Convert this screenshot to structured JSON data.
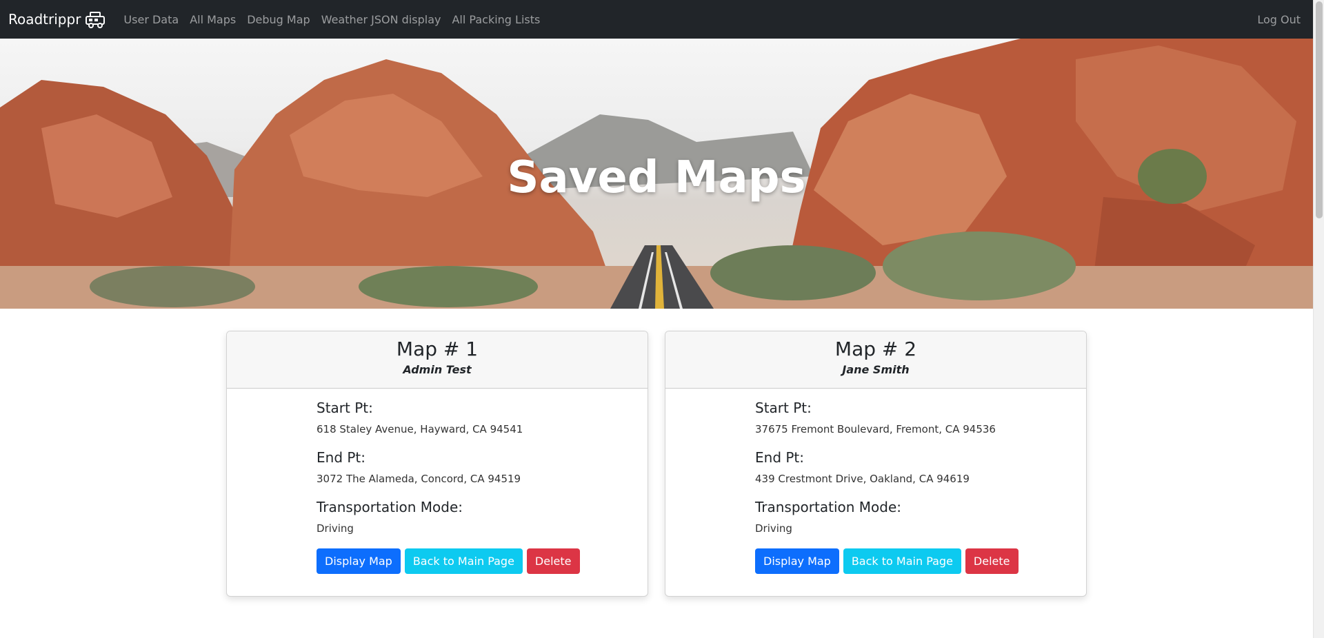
{
  "navbar": {
    "brand": "Roadtrippr",
    "brand_icon": "camper-van-icon",
    "links": [
      "User Data",
      "All Maps",
      "Debug Map",
      "Weather JSON display",
      "All Packing Lists"
    ],
    "logout": "Log Out"
  },
  "hero": {
    "title": "Saved Maps"
  },
  "cards": [
    {
      "title": "Map # 1",
      "owner": "Admin Test",
      "start_label": "Start Pt:",
      "start_value": "618 Staley Avenue, Hayward, CA 94541",
      "end_label": "End Pt:",
      "end_value": "3072 The Alameda, Concord, CA 94519",
      "mode_label": "Transportation Mode:",
      "mode_value": "Driving",
      "buttons": {
        "display": "Display Map",
        "back": "Back to Main Page",
        "delete": "Delete"
      }
    },
    {
      "title": "Map # 2",
      "owner": "Jane Smith",
      "start_label": "Start Pt:",
      "start_value": "37675 Fremont Boulevard, Fremont, CA 94536",
      "end_label": "End Pt:",
      "end_value": "439 Crestmont Drive, Oakland, CA 94619",
      "mode_label": "Transportation Mode:",
      "mode_value": "Driving",
      "buttons": {
        "display": "Display Map",
        "back": "Back to Main Page",
        "delete": "Delete"
      }
    }
  ],
  "colors": {
    "navbar_bg": "#212529",
    "primary": "#0d6efd",
    "info": "#0dcaf0",
    "danger": "#dc3545"
  }
}
